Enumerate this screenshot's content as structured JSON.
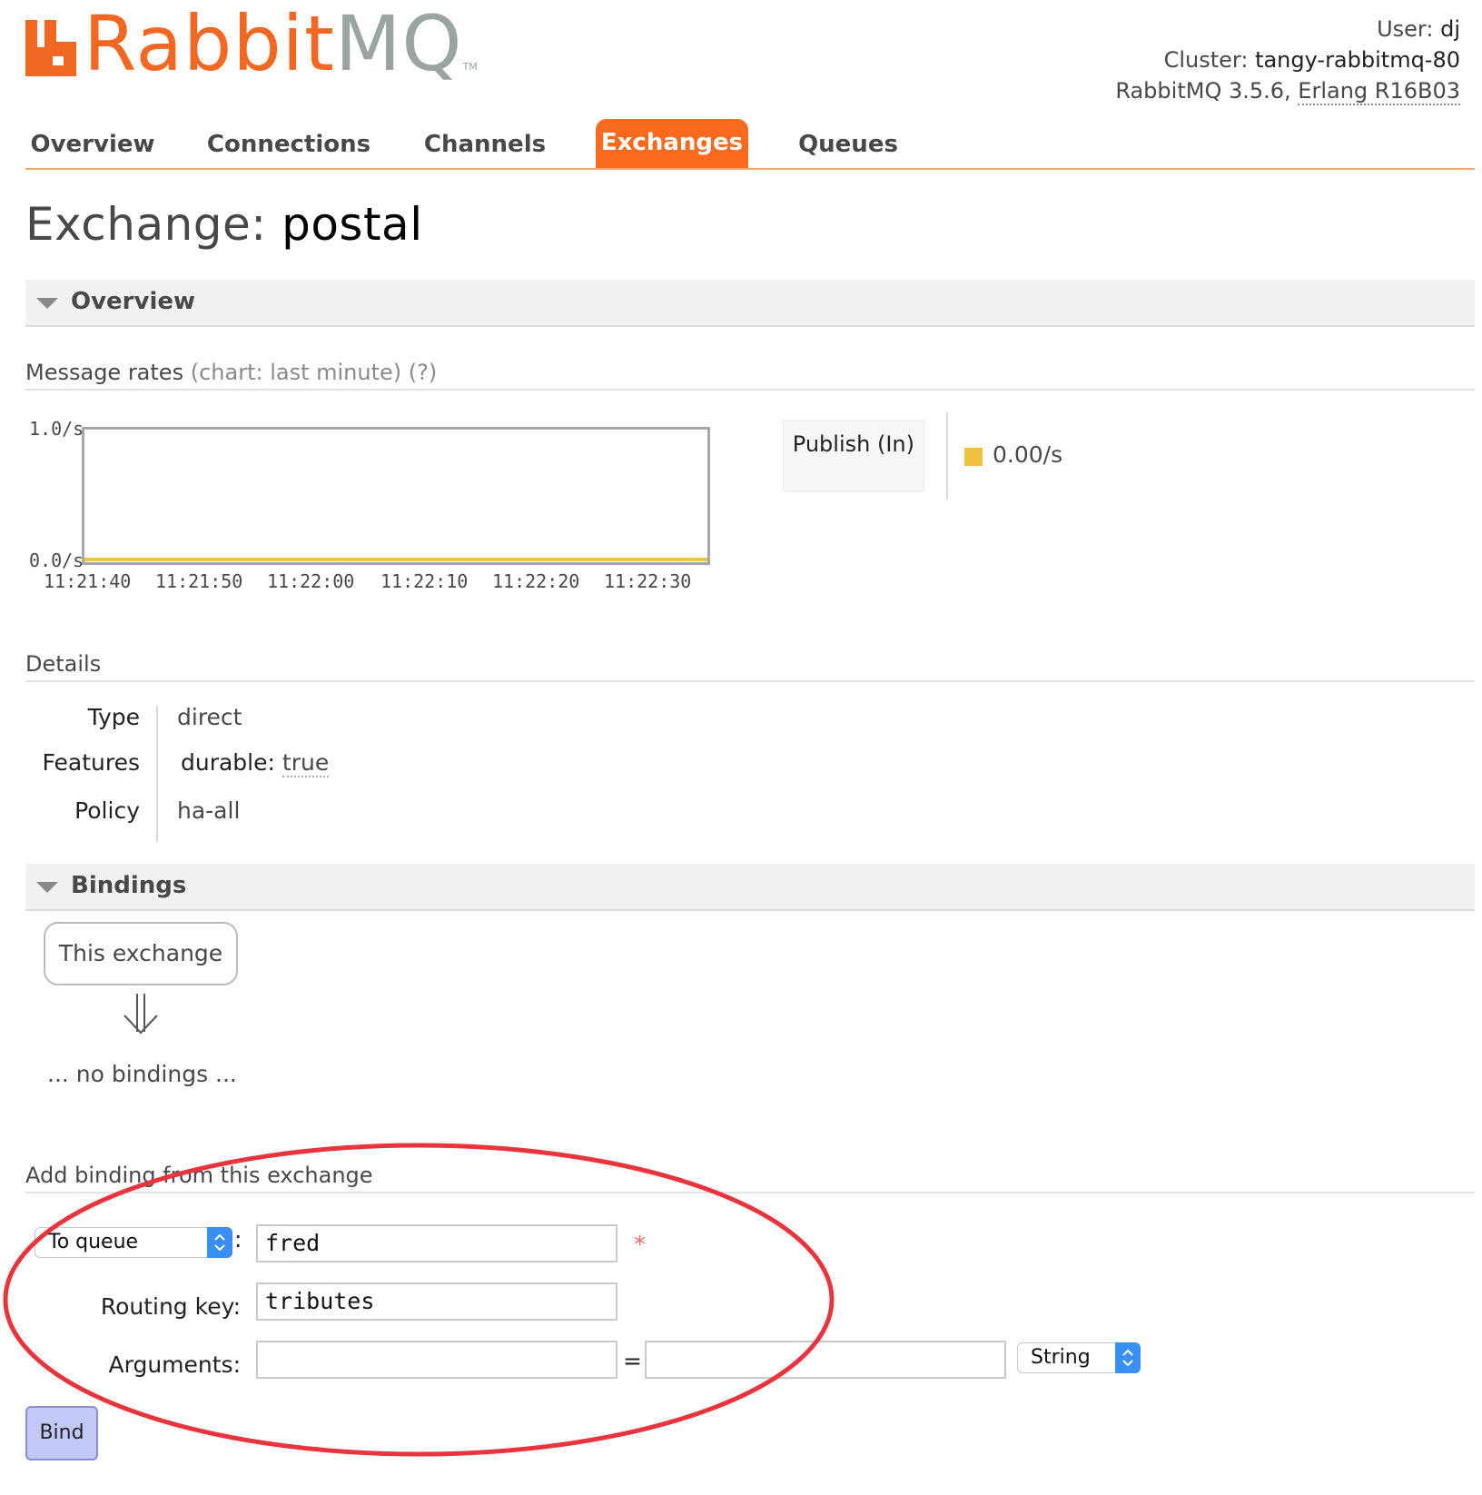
{
  "brand": {
    "rabbit": "Rabbit",
    "mq": "MQ",
    "tm": "TM"
  },
  "header": {
    "user_label": "User:",
    "user": "dj",
    "cluster_label": "Cluster:",
    "cluster": "tangy-rabbitmq-80",
    "version": "RabbitMQ 3.5.6,",
    "erlang": "Erlang R16B03"
  },
  "tabs": [
    {
      "label": "Overview"
    },
    {
      "label": "Connections"
    },
    {
      "label": "Channels"
    },
    {
      "label": "Exchanges",
      "active": true
    },
    {
      "label": "Queues"
    }
  ],
  "page": {
    "title_prefix": "Exchange:",
    "exchange_name": "postal"
  },
  "overview": {
    "section_label": "Overview",
    "rates_label": "Message rates",
    "rates_hint": "(chart: last minute) (?)",
    "legend_label": "Publish (In)",
    "legend_value": "0.00/s"
  },
  "chart_data": {
    "type": "line",
    "x": [
      "11:21:40",
      "11:21:50",
      "11:22:00",
      "11:22:10",
      "11:22:20",
      "11:22:30"
    ],
    "series": [
      {
        "name": "Publish (In)",
        "values": [
          0,
          0,
          0,
          0,
          0,
          0
        ]
      }
    ],
    "ylim": [
      0,
      1
    ],
    "yticks": [
      "0.0/s",
      "1.0/s"
    ],
    "series_color": "#edc240"
  },
  "details": {
    "title": "Details",
    "rows": [
      {
        "key": "Type",
        "value": "direct"
      },
      {
        "key": "Features",
        "feature_key": "durable:",
        "value": "true"
      },
      {
        "key": "Policy",
        "value": "ha-all"
      }
    ]
  },
  "bindings": {
    "section_label": "Bindings",
    "this_exchange": "This exchange",
    "empty": "... no bindings ..."
  },
  "add_binding": {
    "title": "Add binding from this exchange",
    "destination_type": "To queue",
    "destination_value": "fred",
    "required_mark": "*",
    "routing_key_label": "Routing key:",
    "routing_key_value": "tributes",
    "arguments_label": "Arguments:",
    "arguments_key": "",
    "arguments_value": "",
    "equals": "=",
    "arg_type": "String",
    "bind_label": "Bind"
  },
  "colors": {
    "accent": "#f96a1f",
    "annotation": "#e8343d",
    "series": "#edc240"
  }
}
